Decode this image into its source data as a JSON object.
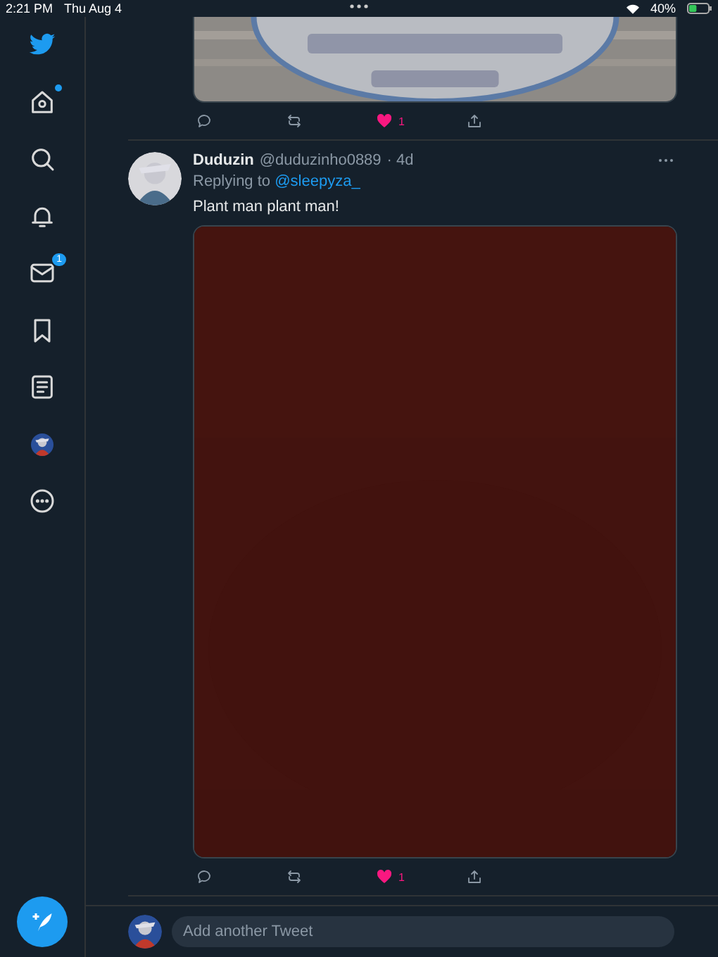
{
  "status_bar": {
    "time": "2:21 PM",
    "date": "Thu Aug 4",
    "battery": "40%"
  },
  "sidebar": {
    "items": [
      {
        "kind": "logo"
      },
      {
        "kind": "home",
        "dot": true
      },
      {
        "kind": "explore"
      },
      {
        "kind": "notifications"
      },
      {
        "kind": "messages",
        "badge": "1"
      },
      {
        "kind": "bookmarks"
      },
      {
        "kind": "lists"
      },
      {
        "kind": "profile"
      },
      {
        "kind": "more"
      }
    ]
  },
  "tweets": [
    {
      "kind": "partial",
      "actions": {
        "liked": true,
        "like_count": "1"
      }
    },
    {
      "kind": "full",
      "name": "Duduzin",
      "handle": "@duduzinho0889",
      "time": "· 4d",
      "replying_to": "Replying to",
      "reply_handle": "@sleepyza_",
      "text": "Plant man plant man!",
      "actions": {
        "liked": true,
        "like_count": "1"
      }
    }
  ],
  "compose": {
    "placeholder": "Add another Tweet"
  }
}
